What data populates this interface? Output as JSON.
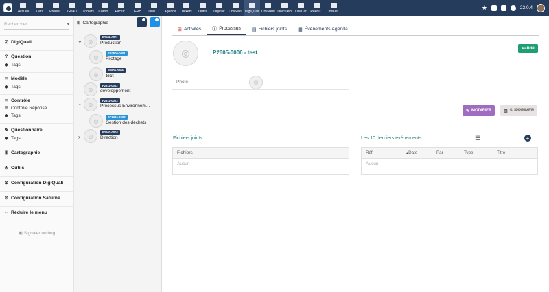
{
  "topbar": {
    "menu": [
      {
        "label": "Accueil",
        "icon": "home-icon"
      },
      {
        "label": "Tiers",
        "icon": "building-icon"
      },
      {
        "label": "Produi...",
        "icon": "box-icon"
      },
      {
        "label": "GPAO",
        "icon": "cube-icon"
      },
      {
        "label": "Projets",
        "icon": "sitemap-icon"
      },
      {
        "label": "Comm...",
        "icon": "suitcase-icon"
      },
      {
        "label": "Factur...",
        "icon": "invoice-icon"
      },
      {
        "label": "GRH",
        "icon": "users-icon"
      },
      {
        "label": "Docu...",
        "icon": "folder-icon"
      },
      {
        "label": "Agenda",
        "icon": "calendar-icon"
      },
      {
        "label": "Tickets",
        "icon": "ticket-icon"
      },
      {
        "label": "Outils",
        "icon": "tools-icon"
      },
      {
        "label": "Digirisk",
        "icon": "triangle-icon"
      },
      {
        "label": "DoliSecu",
        "icon": "lock-icon"
      },
      {
        "label": "DigiQuali",
        "icon": "check-icon",
        "active": true
      },
      {
        "label": "DoliMeet",
        "icon": "meeting-icon"
      },
      {
        "label": "DoliSIRH",
        "icon": "hr-icon"
      },
      {
        "label": "DoliCar",
        "icon": "car-icon"
      },
      {
        "label": "ReedC...",
        "icon": "chart-icon"
      },
      {
        "label": "DoliLet...",
        "icon": "letter-icon"
      }
    ],
    "version": "22.0.4"
  },
  "leftnav": {
    "search_placeholder": "Rechercher",
    "module": "DigiQuali",
    "question": "Question",
    "question_tags": "Tags",
    "modele": "Modèle",
    "modele_tags": "Tags",
    "controle": "Contrôle",
    "controle_reponse": "Contrôle Réponse",
    "controle_tags": "Tags",
    "questionnaire": "Questionnaire",
    "questionnaire_tags": "Tags",
    "cartographie": "Cartographie",
    "outils": "Outils",
    "config_digiquali": "Configuration DigiQuali",
    "config_saturne": "Configuration Saturne",
    "reduire": "Réduire le menu",
    "signaler": "Signaler un bug"
  },
  "tree": {
    "title": "Cartographie",
    "nodes": [
      {
        "ref": "P2506-0001",
        "name": "Production"
      },
      {
        "ref": "SP2506-0001",
        "name": "Pilotage"
      },
      {
        "ref": "P2605-0006",
        "name": "test"
      },
      {
        "ref": "P2511-0002",
        "name": "développement"
      },
      {
        "ref": "P2511-0003",
        "name": "Processus Environnem..."
      },
      {
        "ref": "SP2601-0002",
        "name": "Gestion des déchets"
      },
      {
        "ref": "P2601-0004",
        "name": "Direction"
      }
    ]
  },
  "main": {
    "tabs": [
      "Activités",
      "Processus",
      "Fichiers joints",
      "Événements/Agenda"
    ],
    "title": "P2605-0006 - test",
    "status": "Validé",
    "photo_label": "Photo",
    "btn_edit": "MODIFIER",
    "btn_delete": "SUPPRIMER",
    "files_title": "Fichiers joints",
    "files_col": "Fichiers",
    "files_empty": "Aucun",
    "events_title": "Les 10 derniers événements",
    "events_cols": [
      "Réf.",
      "Date",
      "Par",
      "Type",
      "Titre"
    ],
    "events_empty": "Aucun"
  }
}
